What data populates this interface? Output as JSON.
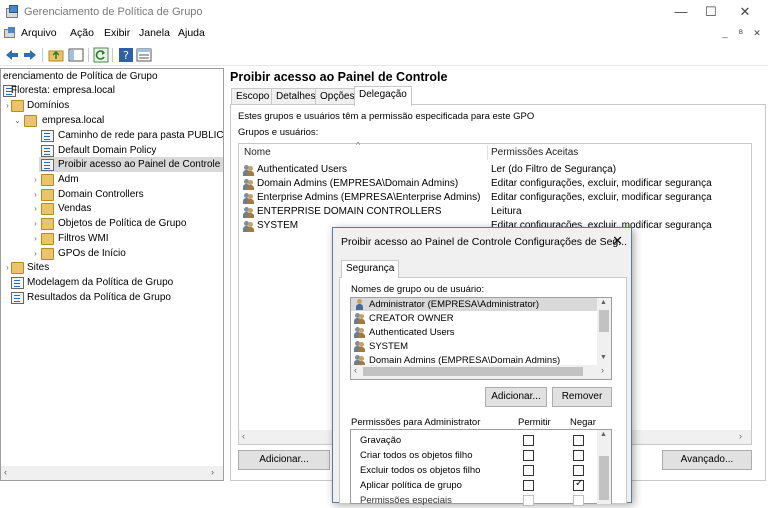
{
  "window": {
    "title": "Gerenciamento de Política de Grupo",
    "controls": {
      "minimize": "—",
      "maximize": "☐",
      "close": "✕"
    }
  },
  "menu": {
    "items": [
      "Arquivo",
      "Ação",
      "Exibir",
      "Janela",
      "Ajuda"
    ],
    "mdi_controls": [
      "_",
      "ᴮ",
      "✕"
    ]
  },
  "toolbar": {
    "icons": [
      "back-icon",
      "forward-icon",
      "folder-up-icon",
      "console-tree-icon",
      "refresh-icon",
      "help-icon",
      "properties-icon"
    ]
  },
  "tree": {
    "items": [
      {
        "label": "erenciamento de Política de Grupo",
        "expander": "",
        "icon": "gpm-icon"
      },
      {
        "label": "Floresta: empresa.local",
        "expander": "",
        "icon": "forest-icon"
      },
      {
        "label": "Domínios",
        "expander": "›",
        "icon": "domains-icon"
      },
      {
        "label": "empresa.local",
        "expander": "⌄",
        "icon": "domain-icon"
      },
      {
        "label": "Caminho de rede para pasta PUBLICA",
        "expander": "",
        "icon": "gpo-link-icon"
      },
      {
        "label": "Default Domain Policy",
        "expander": "",
        "icon": "gpo-link-icon"
      },
      {
        "label": "Proibir acesso ao Painel de Controle",
        "expander": "",
        "icon": "gpo-link-icon"
      },
      {
        "label": "Adm",
        "expander": "›",
        "icon": "ou-folder-icon"
      },
      {
        "label": "Domain Controllers",
        "expander": "›",
        "icon": "ou-folder-icon"
      },
      {
        "label": "Vendas",
        "expander": "›",
        "icon": "ou-folder-icon"
      },
      {
        "label": "Objetos de Política de Grupo",
        "expander": "›",
        "icon": "gpo-folder-icon"
      },
      {
        "label": "Filtros WMI",
        "expander": "›",
        "icon": "wmi-folder-icon"
      },
      {
        "label": "GPOs de Início",
        "expander": "›",
        "icon": "starter-gpo-folder-icon"
      },
      {
        "label": "Sites",
        "expander": "›",
        "icon": "sites-icon"
      },
      {
        "label": "Modelagem da Política de Grupo",
        "expander": "",
        "icon": "modeling-icon"
      },
      {
        "label": "Resultados da Política de Grupo",
        "expander": "",
        "icon": "results-icon"
      }
    ],
    "selected_index": 6
  },
  "gpo": {
    "title": "Proibir acesso ao Painel de Controle",
    "tabs": [
      "Escopo",
      "Detalhes",
      "Opções",
      "Delegação"
    ],
    "active_tab": "Delegação",
    "description": "Estes grupos e usuários têm a permissão especificada para este GPO",
    "group_label": "Grupos e usuários:",
    "columns": [
      "Nome",
      "Permissões Aceitas"
    ],
    "rows": [
      {
        "name": "Authenticated Users",
        "permission": "Ler (do Filtro de Segurança)"
      },
      {
        "name": "Domain Admins (EMPRESA\\Domain Admins)",
        "permission": "Editar configurações, excluir, modificar segurança"
      },
      {
        "name": "Enterprise Admins (EMPRESA\\Enterprise Admins)",
        "permission": "Editar configurações, excluir, modificar segurança"
      },
      {
        "name": "ENTERPRISE DOMAIN CONTROLLERS",
        "permission": "Leitura"
      },
      {
        "name": "SYSTEM",
        "permission": "Editar configurações, excluir, modificar segurança"
      }
    ],
    "add_button": "Adicionar...",
    "advanced_button": "Avançado..."
  },
  "dialog": {
    "title": "Proibir acesso ao Painel de Controle Configurações de Seg...",
    "tab": "Segurança",
    "names_label": "Nomes de grupo ou de usuário:",
    "names": [
      "Administrator (EMPRESA\\Administrator)",
      "CREATOR OWNER",
      "Authenticated Users",
      "SYSTEM",
      "Domain Admins (EMPRESA\\Domain Admins)"
    ],
    "add_button": "Adicionar...",
    "remove_button": "Remover",
    "perms_label": "Permissões para Administrator",
    "allow_col": "Permitir",
    "deny_col": "Negar",
    "permissions": [
      {
        "name": "Gravação",
        "allow": false,
        "deny": false,
        "enabled": true
      },
      {
        "name": "Criar todos os objetos filho",
        "allow": false,
        "deny": false,
        "enabled": true
      },
      {
        "name": "Excluir todos os objetos filho",
        "allow": false,
        "deny": false,
        "enabled": true
      },
      {
        "name": "Aplicar política de grupo",
        "allow": false,
        "deny": true,
        "enabled": true
      },
      {
        "name": "Permissões especiais",
        "allow": false,
        "deny": false,
        "enabled": false
      }
    ]
  }
}
